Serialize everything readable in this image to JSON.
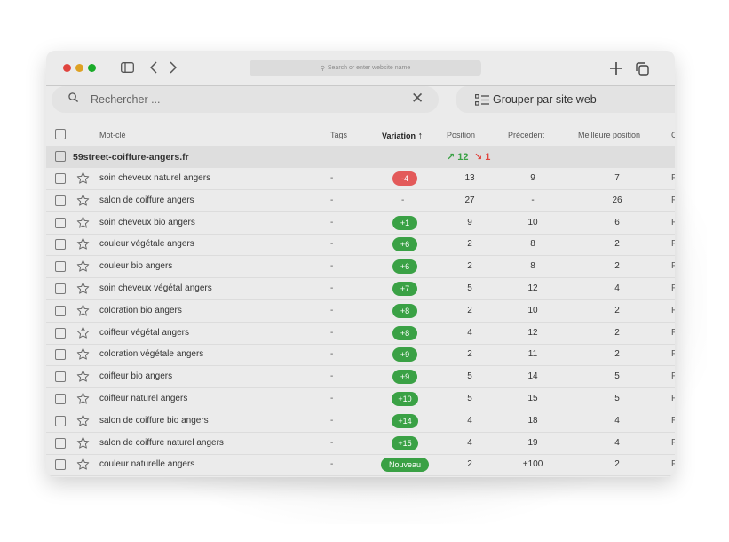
{
  "browser": {
    "url_placeholder": "Search or enter website name",
    "icons": [
      "sidebar-icon",
      "back-icon",
      "forward-icon",
      "plus-icon",
      "tabs-icon"
    ]
  },
  "toolbar": {
    "search_placeholder": "Rechercher ...",
    "group_label": "Grouper par site web"
  },
  "table": {
    "headers": {
      "keyword": "Mot-clé",
      "tags": "Tags",
      "variation": "Variation",
      "position": "Position",
      "previous": "Précedent",
      "best": "Meilleure position",
      "cut": "C"
    },
    "group": {
      "name": "59street-coiffure-angers.fr",
      "up": "↗ 12",
      "down": "↘ 1"
    },
    "colors": {
      "positive": "#3aa145",
      "negative": "#e35a5a"
    },
    "rows": [
      {
        "keyword": "soin cheveux naturel angers",
        "tag": "-",
        "variation": "-4",
        "type": "neg",
        "position": "13",
        "previous": "9",
        "best": "7",
        "cut": "F"
      },
      {
        "keyword": "salon de coiffure angers",
        "tag": "-",
        "variation": "-",
        "type": "none",
        "position": "27",
        "previous": "-",
        "best": "26",
        "cut": "F"
      },
      {
        "keyword": "soin cheveux bio angers",
        "tag": "-",
        "variation": "+1",
        "type": "pos",
        "position": "9",
        "previous": "10",
        "best": "6",
        "cut": "F"
      },
      {
        "keyword": "couleur végétale angers",
        "tag": "-",
        "variation": "+6",
        "type": "pos",
        "position": "2",
        "previous": "8",
        "best": "2",
        "cut": "F"
      },
      {
        "keyword": "couleur bio angers",
        "tag": "-",
        "variation": "+6",
        "type": "pos",
        "position": "2",
        "previous": "8",
        "best": "2",
        "cut": "F"
      },
      {
        "keyword": "soin cheveux végétal angers",
        "tag": "-",
        "variation": "+7",
        "type": "pos",
        "position": "5",
        "previous": "12",
        "best": "4",
        "cut": "F"
      },
      {
        "keyword": "coloration bio angers",
        "tag": "-",
        "variation": "+8",
        "type": "pos",
        "position": "2",
        "previous": "10",
        "best": "2",
        "cut": "F"
      },
      {
        "keyword": "coiffeur végétal angers",
        "tag": "-",
        "variation": "+8",
        "type": "pos",
        "position": "4",
        "previous": "12",
        "best": "2",
        "cut": "F"
      },
      {
        "keyword": "coloration végétale angers",
        "tag": "-",
        "variation": "+9",
        "type": "pos",
        "position": "2",
        "previous": "11",
        "best": "2",
        "cut": "F"
      },
      {
        "keyword": "coiffeur bio angers",
        "tag": "-",
        "variation": "+9",
        "type": "pos",
        "position": "5",
        "previous": "14",
        "best": "5",
        "cut": "F"
      },
      {
        "keyword": "coiffeur naturel angers",
        "tag": "-",
        "variation": "+10",
        "type": "pos",
        "position": "5",
        "previous": "15",
        "best": "5",
        "cut": "F"
      },
      {
        "keyword": "salon de coiffure bio angers",
        "tag": "-",
        "variation": "+14",
        "type": "pos",
        "position": "4",
        "previous": "18",
        "best": "4",
        "cut": "F"
      },
      {
        "keyword": "salon de coiffure naturel angers",
        "tag": "-",
        "variation": "+15",
        "type": "pos",
        "position": "4",
        "previous": "19",
        "best": "4",
        "cut": "F"
      },
      {
        "keyword": "couleur naturelle angers",
        "tag": "-",
        "variation": "Nouveau",
        "type": "new",
        "position": "2",
        "previous": "+100",
        "best": "2",
        "cut": "F"
      }
    ]
  }
}
